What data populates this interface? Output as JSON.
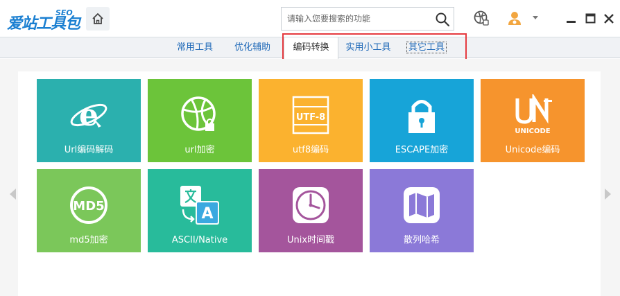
{
  "header": {
    "logo_text": "爱站工具包",
    "logo_sup": "SEO",
    "search_placeholder": "请输入您要搜索的功能"
  },
  "tabs": [
    {
      "label": "常用工具",
      "active": false
    },
    {
      "label": "优化辅助",
      "active": false
    },
    {
      "label": "编码转换",
      "active": true
    },
    {
      "label": "实用小工具",
      "active": false
    },
    {
      "label": "其它工具",
      "active": false
    }
  ],
  "tools": [
    {
      "label": "Url编码解码",
      "icon": "ie-icon",
      "color": "#2bb0ae"
    },
    {
      "label": "url加密",
      "icon": "lock-globe-icon",
      "color": "#6cc43a"
    },
    {
      "label": "utf8编码",
      "icon": "utf8-icon",
      "color": "#fbb22f"
    },
    {
      "label": "ESCAPE加密",
      "icon": "padlock-icon",
      "color": "#17a4d8"
    },
    {
      "label": "Unicode编码",
      "icon": "unicode-icon",
      "color": "#f6942d"
    },
    {
      "label": "md5加密",
      "icon": "md5-icon",
      "color": "#7bc75a"
    },
    {
      "label": "ASCII/Native",
      "icon": "translate-icon",
      "color": "#28bb9b"
    },
    {
      "label": "Unix时间戳",
      "icon": "clock-icon",
      "color": "#a4559c"
    },
    {
      "label": "散列哈希",
      "icon": "map-icon",
      "color": "#8b79d8"
    }
  ],
  "unicode_icon_text": "UNICODE",
  "utf8_icon_text": "UTF-8",
  "md5_icon_text": "MD5",
  "translate_icon_text": "A"
}
